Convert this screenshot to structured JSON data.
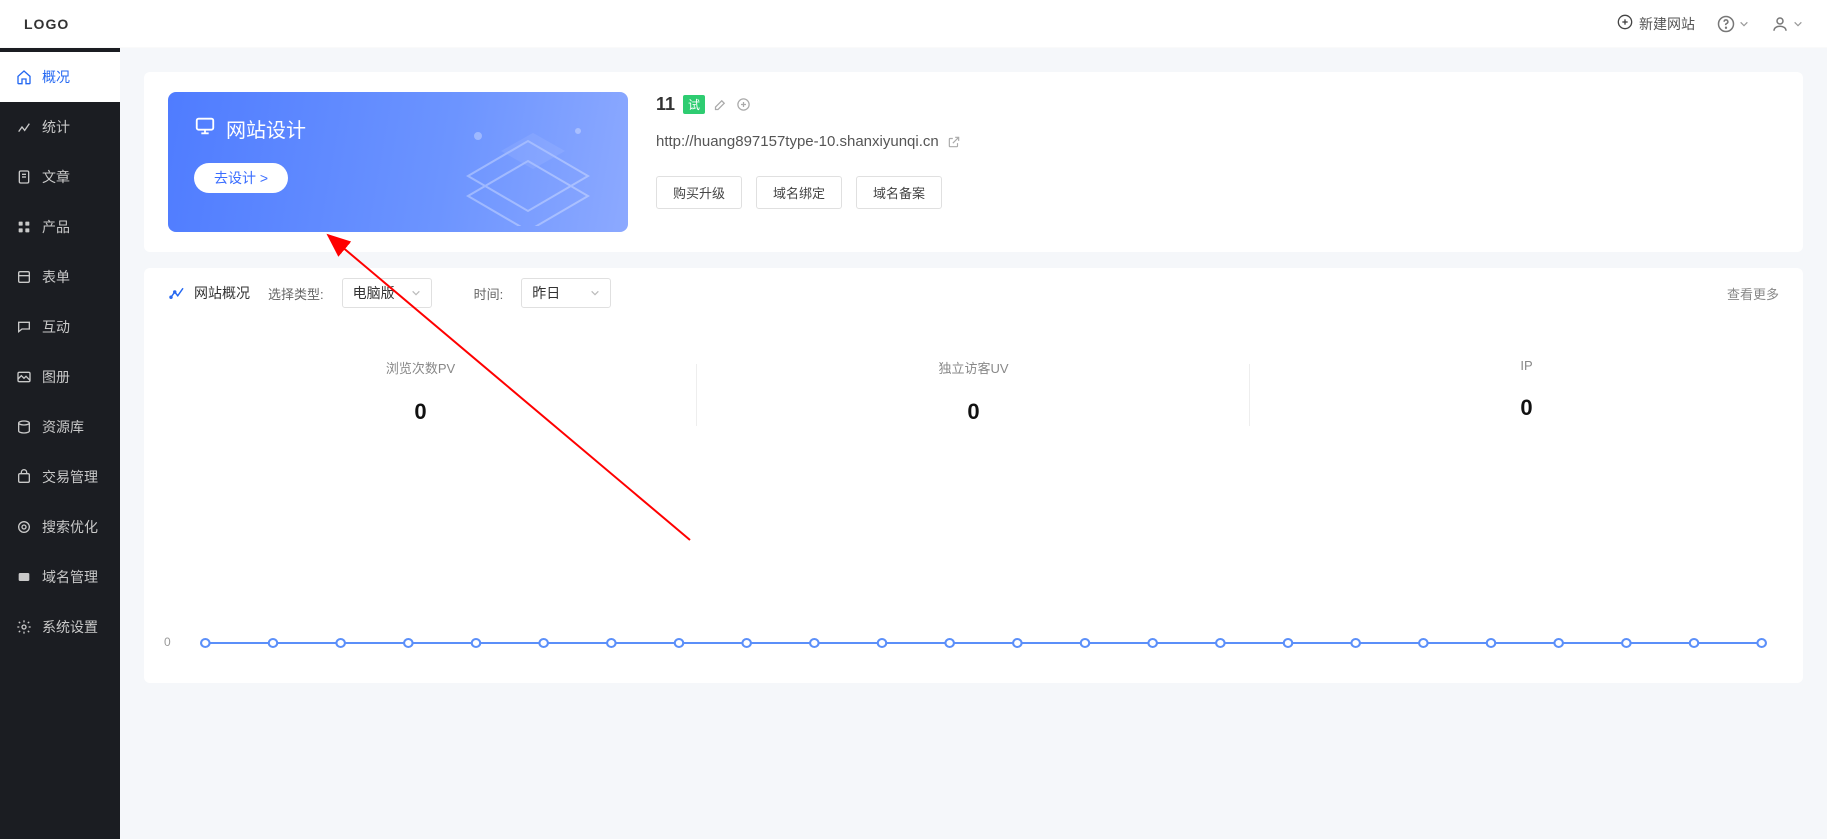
{
  "topbar": {
    "logo": "LOGO",
    "new_site": "新建网站"
  },
  "sidebar": {
    "items": [
      {
        "label": "概况",
        "icon": "home"
      },
      {
        "label": "统计",
        "icon": "chart"
      },
      {
        "label": "文章",
        "icon": "doc"
      },
      {
        "label": "产品",
        "icon": "grid"
      },
      {
        "label": "表单",
        "icon": "form"
      },
      {
        "label": "互动",
        "icon": "chat"
      },
      {
        "label": "图册",
        "icon": "gallery"
      },
      {
        "label": "资源库",
        "icon": "db"
      },
      {
        "label": "交易管理",
        "icon": "cart"
      },
      {
        "label": "搜索优化",
        "icon": "seo"
      },
      {
        "label": "域名管理",
        "icon": "domain"
      },
      {
        "label": "系统设置",
        "icon": "gear"
      }
    ]
  },
  "design_card": {
    "title": "网站设计",
    "cta": "去设计 >"
  },
  "site": {
    "name": "11",
    "badge": "试",
    "url": "http://huang897157type-10.shanxiyunqi.cn",
    "buttons": {
      "upgrade": "购买升级",
      "bind_domain": "域名绑定",
      "record": "域名备案"
    }
  },
  "stats": {
    "title": "网站概况",
    "type_label": "选择类型:",
    "type_value": "电脑版",
    "time_label": "时间:",
    "time_value": "昨日",
    "more": "查看更多",
    "kpis": [
      {
        "label": "浏览次数PV",
        "value": "0"
      },
      {
        "label": "独立访客UV",
        "value": "0"
      },
      {
        "label": "IP",
        "value": "0"
      }
    ]
  },
  "chart_data": {
    "type": "line",
    "title": "",
    "xlabel": "",
    "ylabel": "",
    "ylim": [
      0,
      1
    ],
    "y_ticks": [
      0
    ],
    "x": [
      0,
      1,
      2,
      3,
      4,
      5,
      6,
      7,
      8,
      9,
      10,
      11,
      12,
      13,
      14,
      15,
      16,
      17,
      18,
      19,
      20,
      21,
      22,
      23
    ],
    "series": [
      {
        "name": "",
        "color": "#5b8ff9",
        "values": [
          0,
          0,
          0,
          0,
          0,
          0,
          0,
          0,
          0,
          0,
          0,
          0,
          0,
          0,
          0,
          0,
          0,
          0,
          0,
          0,
          0,
          0,
          0,
          0
        ]
      }
    ]
  }
}
